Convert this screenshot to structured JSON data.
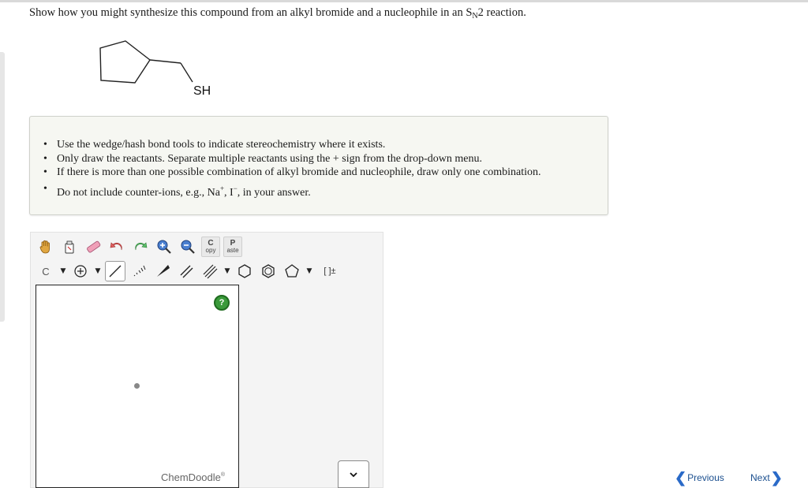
{
  "question": {
    "text_before": "Show how you might synthesize this compound from an alkyl bromide and a nucleophile in an S",
    "subscript": "N",
    "text_after": "2 reaction."
  },
  "molecule": {
    "label": "SH"
  },
  "instructions": {
    "items": [
      "Use the wedge/hash bond tools to indicate stereochemistry where it exists.",
      "Only draw the reactants. Separate multiple reactants using the + sign from the drop-down menu.",
      "If there is more than one possible combination of alkyl bromide and nucleophile, draw only one combination."
    ],
    "last_item": {
      "part1": "Do not include counter-ions, e.g., Na",
      "sup1": "+",
      "part2": ", I",
      "sup2": "−",
      "part3": ", in your answer."
    }
  },
  "toolbar": {
    "copy_big": "C",
    "copy_small": "opy",
    "paste_big": "P",
    "paste_small": "aste",
    "element": "C",
    "bracket": "[ ]±",
    "help": "?"
  },
  "editor": {
    "brand": "ChemDoodle",
    "brand_mark": "®"
  },
  "navigation": {
    "previous": "Previous",
    "next": "Next"
  },
  "icons": {
    "prev_arrow": "❮",
    "next_arrow": "❯",
    "caret": "▼",
    "bullet": "•"
  }
}
